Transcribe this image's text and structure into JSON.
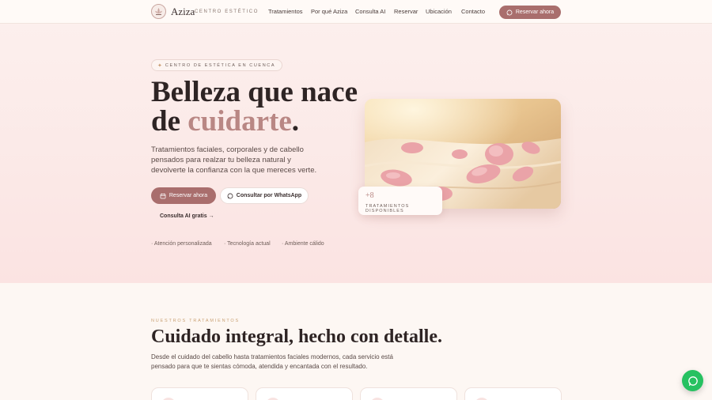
{
  "brand": {
    "name": "Aziza",
    "tagline": "CENTRO ESTÉTICO"
  },
  "nav": {
    "items": [
      {
        "label": "Tratamientos"
      },
      {
        "label": "Por qué Aziza"
      },
      {
        "label": "Consulta AI"
      },
      {
        "label": "Reservar"
      },
      {
        "label": "Ubicación"
      },
      {
        "label": "Contacto"
      }
    ],
    "cta_label": "Reservar ahora"
  },
  "hero": {
    "badge": "CENTRO DE ESTÉTICA EN CUENCA",
    "title_line1": "Belleza que nace",
    "title_line2_prefix": "de ",
    "title_accent": "cuidarte",
    "title_suffix": ".",
    "lead": "Tratamientos faciales, corporales y de cabello pensados para realzar tu belleza natural y devolverte la confianza con la que mereces verte.",
    "primary_button": "Reservar ahora",
    "secondary_button": "Consultar por WhatsApp",
    "ai_link": "Consulta AI gratis →",
    "features": [
      "· Atención personalizada",
      "· Tecnología actual",
      "· Ambiente cálido"
    ],
    "stat": {
      "value": "+8",
      "label": "TRATAMIENTOS DISPONIBLES"
    }
  },
  "treatments": {
    "eyebrow": "NUESTROS TRATAMIENTOS",
    "title": "Cuidado integral, hecho con detalle.",
    "description": "Desde el cuidado del cabello hasta tratamientos faciales modernos, cada servicio está pensado para que te sientas cómoda, atendida y encantada con el resultado."
  },
  "colors": {
    "accent": "#a96e6d",
    "accent_soft": "#b98784",
    "gold": "#c9a174",
    "whatsapp": "#26c161"
  },
  "icons": {
    "logo": "lotus-emblem-icon",
    "chat": "chat-bubble-icon",
    "calendar": "calendar-icon",
    "sparkle": "sparkle-icon",
    "whatsapp": "whatsapp-icon"
  }
}
